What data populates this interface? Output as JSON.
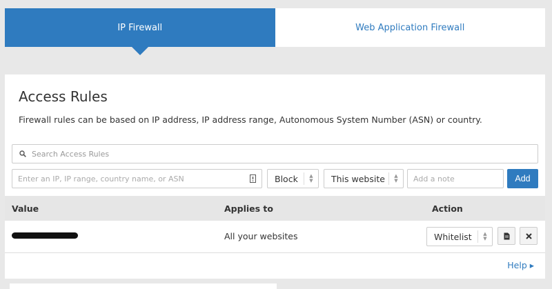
{
  "tabs": [
    {
      "label": "IP Firewall",
      "active": true
    },
    {
      "label": "Web Application Firewall",
      "active": false
    }
  ],
  "access_rules": {
    "title": "Access Rules",
    "description": "Firewall rules can be based on IP address, IP address range, Autonomous System Number (ASN) or country.",
    "search_placeholder": "Search Access Rules",
    "ip_placeholder": "Enter an IP, IP range, country name, or ASN",
    "mode_value": "Block",
    "scope_value": "This website",
    "note_placeholder": "Add a note",
    "add_label": "Add"
  },
  "table": {
    "headers": {
      "value": "Value",
      "applies_to": "Applies to",
      "action": "Action"
    },
    "rows": [
      {
        "applies_to": "All your websites",
        "action": "Whitelist"
      }
    ]
  },
  "help_label": "Help ▸",
  "colors": {
    "accent": "#2f7bbf",
    "background": "#e8e8e8",
    "header_row": "#e6e6e6"
  }
}
